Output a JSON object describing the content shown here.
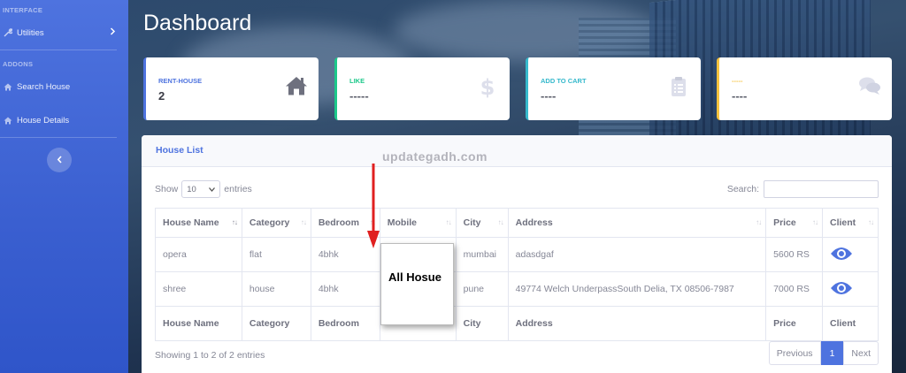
{
  "sidebar": {
    "heading_interface": "INTERFACE",
    "utilities_label": "Utilities",
    "heading_addons": "ADDONS",
    "search_house_label": "Search House",
    "house_details_label": "House Details",
    "toggle_icon": "chevron-left-icon"
  },
  "header": {
    "title": "Dashboard"
  },
  "cards": [
    {
      "label": "RENT-HOUSE",
      "value": "2",
      "icon": "home-icon",
      "accent": "#4e73df"
    },
    {
      "label": "LIKE",
      "value": "-----",
      "icon": "dollar-icon",
      "accent": "#1cc88a"
    },
    {
      "label": "ADD TO CART",
      "value": "----",
      "icon": "clipboard-icon",
      "accent": "#36b9cc"
    },
    {
      "label": "-----",
      "value": "----",
      "icon": "comments-icon",
      "accent": "#f6c23e"
    }
  ],
  "house_list": {
    "title": "House List",
    "show_label": "Show",
    "entries_value": "10",
    "entries_label": "entries",
    "search_label": "Search:",
    "columns": [
      "House Name",
      "Category",
      "Bedroom",
      "Mobile",
      "City",
      "Address",
      "Price",
      "Client"
    ],
    "rows": [
      {
        "house_name": "opera",
        "category": "flat",
        "bedroom": "4bhk",
        "mobile": "",
        "city": "mumbai",
        "address": "adasdgaf",
        "price": "5600 RS",
        "client_icon": "eye-icon"
      },
      {
        "house_name": "shree",
        "category": "house",
        "bedroom": "4bhk",
        "mobile": "",
        "city": "pune",
        "address": "49774 Welch UnderpassSouth Delia, TX 08506-7987",
        "price": "7000 RS",
        "client_icon": "eye-icon"
      }
    ],
    "footer_columns": [
      "House Name",
      "Category",
      "Bedroom",
      "",
      "City",
      "Address",
      "Price",
      "Client"
    ],
    "info": "Showing 1 to 2 of 2 entries",
    "pagination": {
      "previous": "Previous",
      "current": "1",
      "next": "Next"
    }
  },
  "overlay": {
    "watermark": "updategadh.com",
    "callout": "All Hosue",
    "arrow_color": "#e02020"
  },
  "colors": {
    "primary": "#4e73df"
  }
}
